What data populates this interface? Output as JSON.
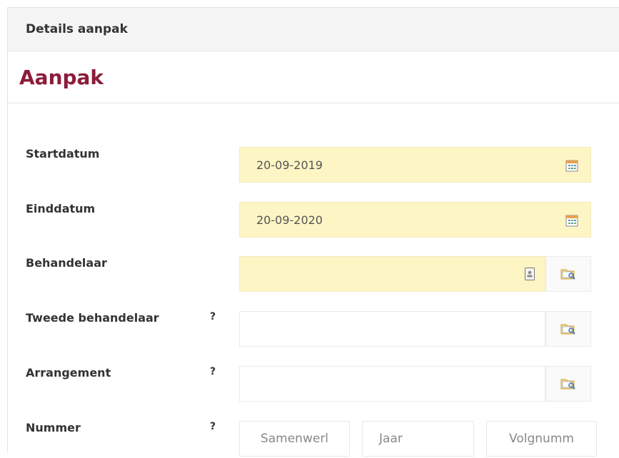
{
  "panel": {
    "title": "Details aanpak"
  },
  "section": {
    "title": "Aanpak"
  },
  "fields": {
    "startdatum": {
      "label": "Startdatum",
      "value": "20-09-2019",
      "icon": "calendar-icon"
    },
    "einddatum": {
      "label": "Einddatum",
      "value": "20-09-2020",
      "icon": "calendar-icon"
    },
    "behandelaar": {
      "label": "Behandelaar",
      "value": "",
      "icon": "contact-card-icon",
      "lookup_icon": "folder-search-icon"
    },
    "tweede_behandelaar": {
      "label": "Tweede behandelaar",
      "help": "?",
      "value": "",
      "lookup_icon": "folder-search-icon"
    },
    "arrangement": {
      "label": "Arrangement",
      "help": "?",
      "value": "",
      "lookup_icon": "folder-search-icon"
    },
    "nummer": {
      "label": "Nummer",
      "help": "?",
      "parts": [
        {
          "placeholder": "Samenwerl"
        },
        {
          "placeholder": "Jaar"
        },
        {
          "placeholder": "Volgnumm"
        }
      ]
    }
  },
  "colors": {
    "accent": "#8b1d3a",
    "required_bg": "#fdf5c4"
  }
}
